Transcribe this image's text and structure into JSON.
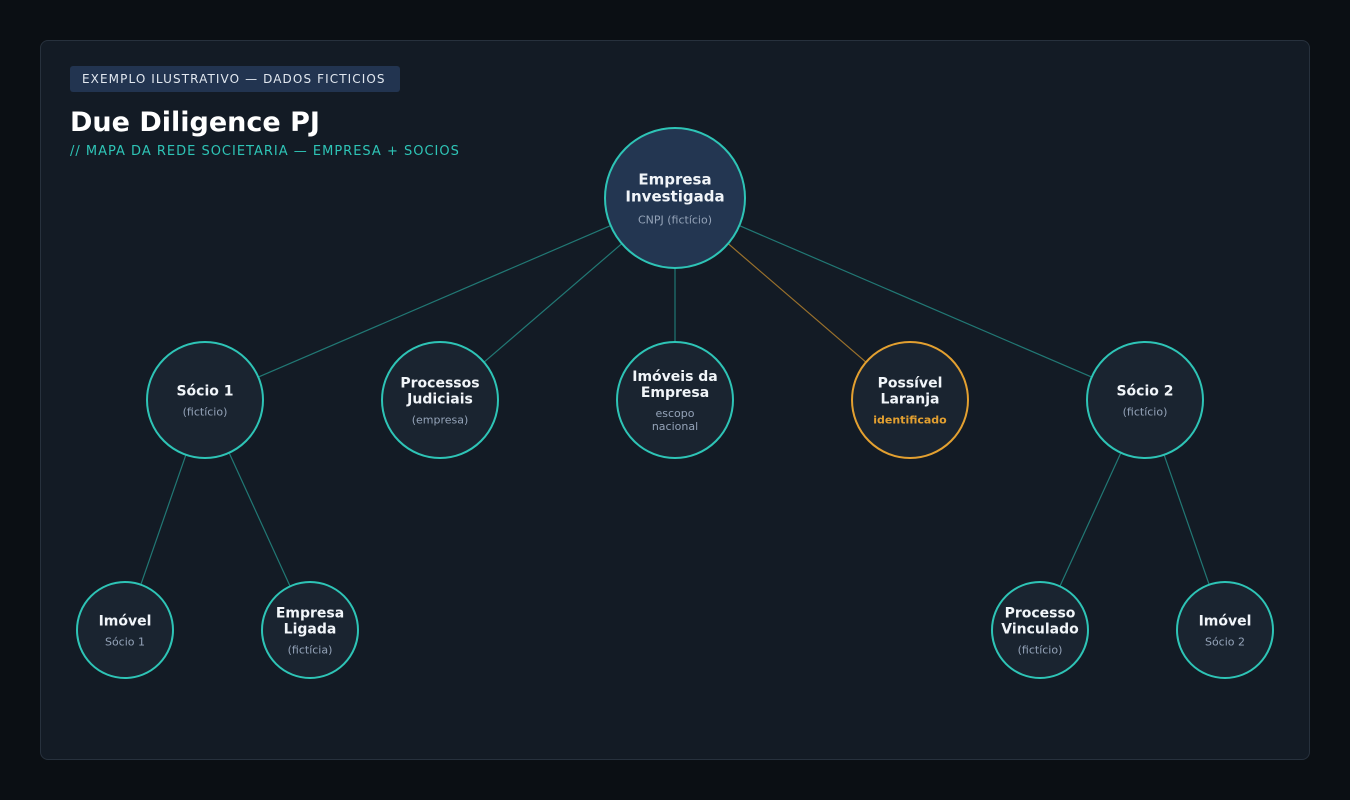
{
  "header": {
    "badge": "EXEMPLO ILUSTRATIVO — DADOS FICTICIOS",
    "title": "Due Diligence PJ",
    "subtitle": "// MAPA DA REDE SOCIETARIA — EMPRESA + SOCIOS"
  },
  "colors": {
    "background": "#0b0f14",
    "card": "#131b25",
    "node_fill": "#1a2430",
    "root_fill": "#233651",
    "accent": "#2ec4b6",
    "alert": "#e3a030",
    "badge_bg": "#223450"
  },
  "nodes": {
    "root": {
      "label": [
        "Empresa",
        "Investigada"
      ],
      "sub": [
        "CNPJ (fictício)"
      ]
    },
    "socio1": {
      "label": [
        "Sócio 1"
      ],
      "sub": [
        "(fictício)"
      ]
    },
    "processos": {
      "label": [
        "Processos",
        "Judiciais"
      ],
      "sub": [
        "(empresa)"
      ]
    },
    "imoveis": {
      "label": [
        "Imóveis da",
        "Empresa"
      ],
      "sub": [
        "escopo",
        "nacional"
      ]
    },
    "laranja": {
      "label": [
        "Possível",
        "Laranja"
      ],
      "sub": [
        "identificado"
      ],
      "status": "alert"
    },
    "socio2": {
      "label": [
        "Sócio 2"
      ],
      "sub": [
        "(fictício)"
      ]
    },
    "imovel1": {
      "label": [
        "Imóvel"
      ],
      "sub": [
        "Sócio 1"
      ]
    },
    "ligada": {
      "label": [
        "Empresa",
        "Ligada"
      ],
      "sub": [
        "(fictícia)"
      ]
    },
    "vinculado": {
      "label": [
        "Processo",
        "Vinculado"
      ],
      "sub": [
        "(fictício)"
      ]
    },
    "imovel2": {
      "label": [
        "Imóvel"
      ],
      "sub": [
        "Sócio 2"
      ]
    }
  },
  "edges": [
    {
      "from": "root",
      "to": "socio1"
    },
    {
      "from": "root",
      "to": "processos"
    },
    {
      "from": "root",
      "to": "imoveis"
    },
    {
      "from": "root",
      "to": "laranja",
      "status": "alert"
    },
    {
      "from": "root",
      "to": "socio2"
    },
    {
      "from": "socio1",
      "to": "imovel1"
    },
    {
      "from": "socio1",
      "to": "ligada"
    },
    {
      "from": "socio2",
      "to": "vinculado"
    },
    {
      "from": "socio2",
      "to": "imovel2"
    }
  ]
}
